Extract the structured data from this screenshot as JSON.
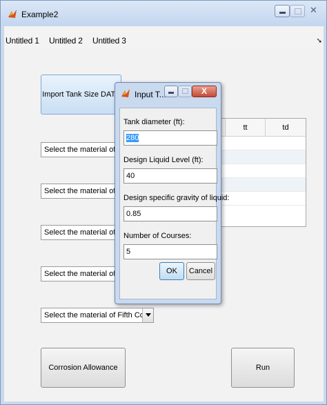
{
  "window": {
    "title": "Example2"
  },
  "tabs": [
    "Untitled 1",
    "Untitled 2",
    "Untitled 3"
  ],
  "main": {
    "import_button": "Import Tank Size DATA",
    "selects": [
      "Select the material of First Course:",
      "Select the material of Second Course:",
      "Select the material of Third Course:",
      "Select the material of Fourth Course:",
      "Select the material of Fifth Course:"
    ],
    "table_headers": [
      "",
      "tt",
      "td"
    ],
    "corrosion_button": "Corrosion Allowance",
    "run_button": "Run"
  },
  "dialog": {
    "title": "Input T...",
    "fields": [
      {
        "label": "Tank diameter (ft):",
        "value": "280"
      },
      {
        "label": "Design Liquid Level (ft):",
        "value": "40"
      },
      {
        "label": "Design specific gravity of liquid:",
        "value": "0.85"
      },
      {
        "label": "Number of Courses:",
        "value": "5"
      }
    ],
    "ok": "OK",
    "cancel": "Cancel"
  },
  "colors": {
    "accent": "#3399ff",
    "close": "#c44b35"
  }
}
